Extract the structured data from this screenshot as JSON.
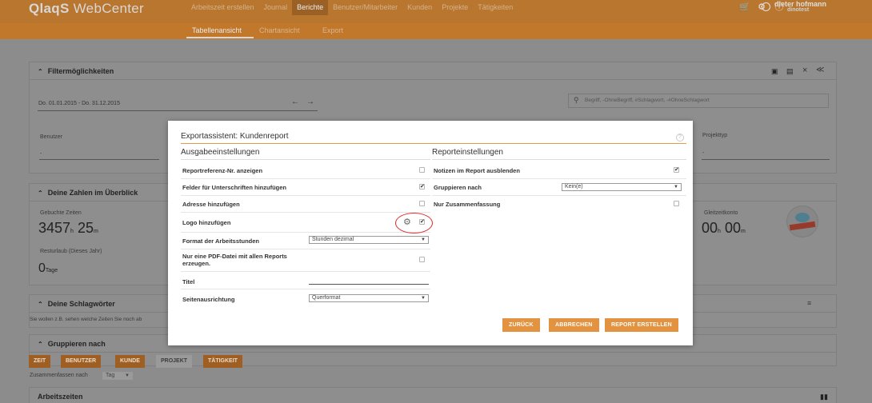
{
  "app": {
    "logo_bold": "QlaqS",
    "logo_thin": " WebCenter"
  },
  "topnav": [
    "Arbeitszeit erstellen",
    "Journal",
    "Berichte",
    "Benutzer/Mitarbeiter",
    "Kunden",
    "Projekte",
    "Tätigkeiten"
  ],
  "active_topnav": "Berichte",
  "user": {
    "name": "dieter hofmann",
    "account": "dinotest"
  },
  "subnav": {
    "table": "Tabellenansicht",
    "chart": "Chartansicht",
    "export": "Export"
  },
  "filter": {
    "title": "Filtermöglichkeiten",
    "date_range": "Do. 01.01.2015 - Do. 31.12.2015",
    "search_placeholder": "Begriff, -OhneBegriff, #Schlagwort, -#OhneSchlagwort",
    "benutzer_label": "Benutzer",
    "benutzer_value": "-",
    "projekttyp_label": "Projekttyp",
    "projekttyp_value": "-"
  },
  "zahlen": {
    "title": "Deine Zahlen im Überblick",
    "gebuchte_label": "Gebuchte Zeiten",
    "gebuchte_h": "3457",
    "gebuchte_m": "25",
    "unit_h": "h",
    "unit_m": "m",
    "resturlaub_label": "Resturlaub (Dieses Jahr)",
    "resturlaub_value": "0",
    "resturlaub_unit": "Tage",
    "gleitzeit_label": "Gleitzeitkonto",
    "gleitzeit_h": "00",
    "gleitzeit_m": "00"
  },
  "schlagwoerter": {
    "title": "Deine Schlagwörter",
    "hint": "Sie wollen z.B. sehen welche Zeiten Sie noch ab"
  },
  "gruppieren": {
    "title": "Gruppieren nach",
    "buttons": [
      "ZEIT",
      "BENUTZER",
      "KUNDE",
      "PROJEKT",
      "TÄTIGKEIT"
    ],
    "zusammenfassen_label": "Zusammenfassen nach",
    "zusammenfassen_value": "Tag"
  },
  "arbeitszeiten": {
    "title": "Arbeitszeiten"
  },
  "modal": {
    "title": "Exportassistent: Kundenreport",
    "help": "?",
    "left_section": "Ausgabeeinstellungen",
    "right_section": "Reporteinstellungen",
    "left_rows": {
      "reportref": {
        "label": "Reportreferenz-Nr. anzeigen",
        "checked": false
      },
      "felder": {
        "label": "Felder für Unterschriften hinzufügen",
        "checked": true
      },
      "adresse": {
        "label": "Adresse hinzufügen",
        "checked": false
      },
      "logo": {
        "label": "Logo hinzufügen",
        "checked": true
      },
      "format": {
        "label": "Format der Arbeitsstunden",
        "value": "Stunden dezimal"
      },
      "pdf": {
        "label": "Nur eine PDF-Datei mit allen Reports erzeugen.",
        "checked": false
      },
      "titel": {
        "label": "Titel",
        "value": ""
      },
      "seiten": {
        "label": "Seitenausrichtung",
        "value": "Querformat"
      }
    },
    "right_rows": {
      "notizen": {
        "label": "Notizen im Report ausblenden",
        "checked": true
      },
      "gruppieren": {
        "label": "Gruppieren nach",
        "value": "Kein(e)"
      },
      "zusammenfassung": {
        "label": "Nur Zusammenfassung",
        "checked": false
      }
    },
    "buttons": {
      "back": "ZURÜCK",
      "cancel": "ABBRECHEN",
      "create": "REPORT ERSTELLEN"
    }
  },
  "colors": {
    "accent": "#e3923f",
    "topbar": "#b9762f",
    "overlay": "#8c8c8c"
  }
}
